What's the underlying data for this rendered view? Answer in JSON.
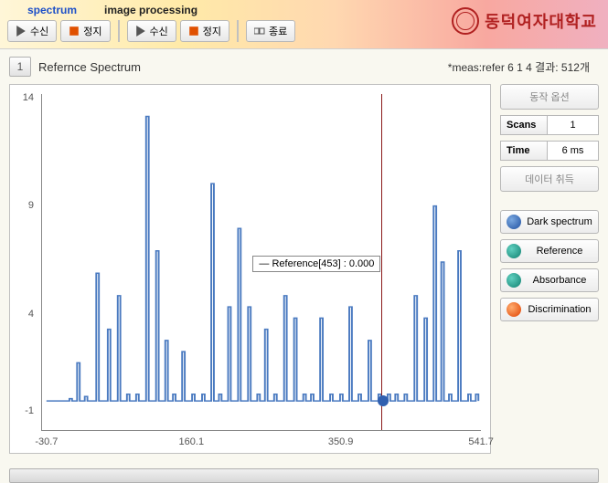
{
  "tabs": {
    "spectrum": "spectrum",
    "image_processing": "image processing"
  },
  "toolbar": {
    "receive": "수신",
    "stop": "정지",
    "exit": "종료"
  },
  "logo_text": "동덕여자대학교",
  "title": {
    "num": "1",
    "text": "Refernce Spectrum"
  },
  "status": "*meas:refer 6 1 4 결과: 512개",
  "sidebar": {
    "opts": "동작 옵션",
    "scans_label": "Scans",
    "scans_val": "1",
    "time_label": "Time",
    "time_val": "6 ms",
    "acquire": "데이터 취득",
    "dark": "Dark spectrum",
    "reference": "Reference",
    "absorbance": "Absorbance",
    "discrimination": "Discrimination"
  },
  "tooltip": "Reference[453] : 0.000",
  "axes": {
    "y": [
      "14",
      "9",
      "4",
      "-1"
    ],
    "x": [
      "-30.7",
      "160.1",
      "350.9",
      "541.7"
    ]
  },
  "chart_data": {
    "type": "line",
    "title": "Refernce Spectrum",
    "xlabel": "",
    "ylabel": "",
    "xlim": [
      -30.7,
      541.7
    ],
    "ylim": [
      -1,
      14
    ],
    "series": [
      {
        "name": "Reference",
        "color": "#4a7ac0",
        "x": [
          -25,
          -10,
          5,
          15,
          25,
          40,
          55,
          68,
          80,
          92,
          105,
          118,
          130,
          140,
          152,
          165,
          178,
          190,
          200,
          212,
          225,
          238,
          250,
          260,
          272,
          285,
          298,
          310,
          320,
          332,
          345,
          358,
          370,
          382,
          395,
          408,
          420,
          430,
          442,
          455,
          468,
          480,
          490,
          500,
          512,
          525,
          535
        ],
        "y": [
          0.3,
          0.3,
          0.4,
          2.0,
          0.5,
          6.0,
          3.5,
          5.0,
          0.6,
          0.6,
          13.0,
          7.0,
          3.0,
          0.6,
          2.5,
          0.6,
          0.6,
          10.0,
          0.6,
          4.5,
          8.0,
          4.5,
          0.6,
          3.5,
          0.6,
          5.0,
          4.0,
          0.6,
          0.6,
          4.0,
          0.6,
          0.6,
          4.5,
          0.6,
          3.0,
          0.6,
          0.6,
          0.6,
          0.6,
          5.0,
          4.0,
          9.0,
          6.5,
          0.6,
          7.0,
          0.6,
          0.6
        ]
      }
    ],
    "cursor": {
      "x": 453,
      "y": 0.0
    }
  }
}
